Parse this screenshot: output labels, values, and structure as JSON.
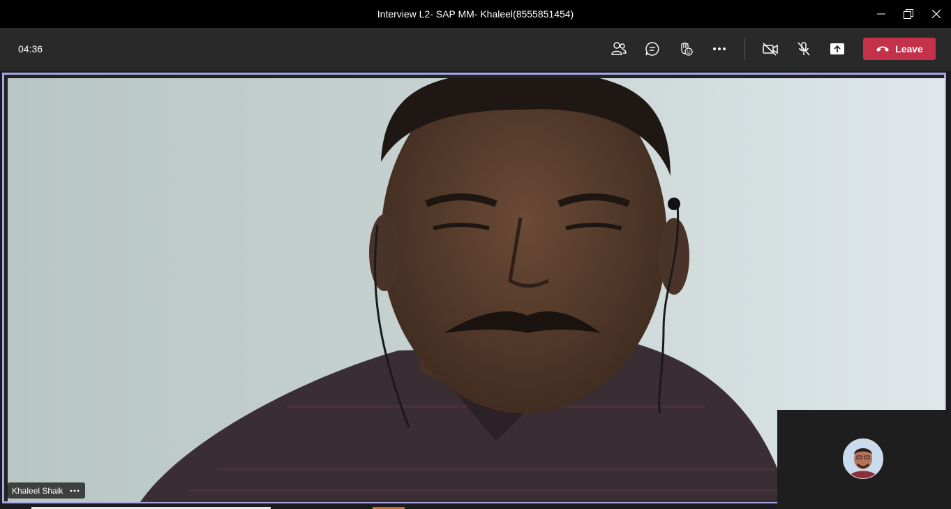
{
  "window": {
    "title": "Interview L2- SAP MM- Khaleel(8555851454)",
    "minimize_icon": "minimize-icon",
    "maximize_icon": "restore-icon",
    "close_icon": "close-icon"
  },
  "toolbar": {
    "timer": "04:36",
    "leave_label": "Leave",
    "buttons": [
      {
        "name": "participants",
        "icon": "people-icon"
      },
      {
        "name": "chat",
        "icon": "chat-icon"
      },
      {
        "name": "reactions",
        "icon": "raise-hand-icon"
      },
      {
        "name": "more",
        "icon": "more-icon"
      },
      {
        "name": "camera",
        "icon": "camera-off-icon"
      },
      {
        "name": "mic",
        "icon": "mic-off-icon"
      },
      {
        "name": "share",
        "icon": "share-icon"
      }
    ],
    "accent": "#c4314b"
  },
  "stage": {
    "participant_name": "Khaleel Shaik",
    "active_speaker_border": "#a7a6e6"
  },
  "self_view": {
    "avatar": "user-avatar"
  }
}
